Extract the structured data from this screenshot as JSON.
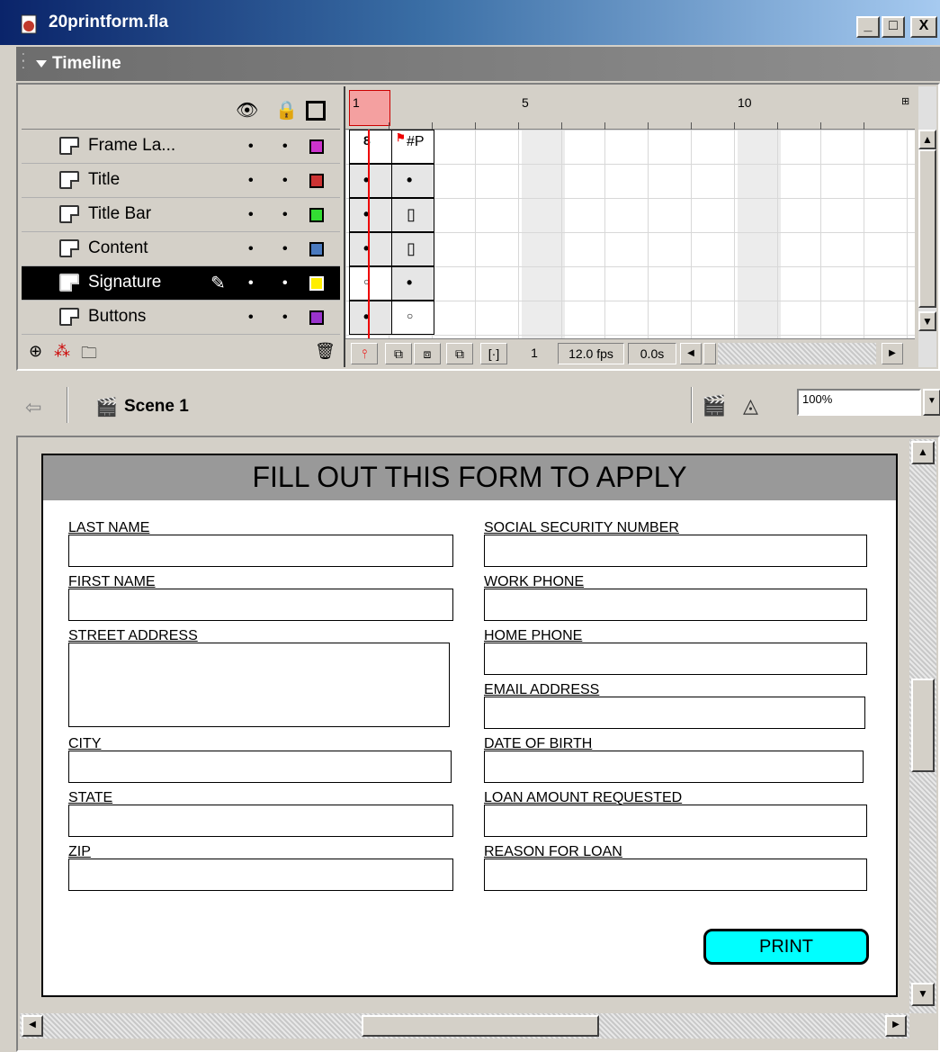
{
  "window": {
    "title": "20printform.fla",
    "min": "_",
    "max": "□",
    "close": "X"
  },
  "timeline": {
    "label": "Timeline",
    "layers": [
      {
        "name": "Frame La...",
        "color": "#cc33cc"
      },
      {
        "name": "Title",
        "color": "#cc3333"
      },
      {
        "name": "Title Bar",
        "color": "#33dd33"
      },
      {
        "name": "Content",
        "color": "#4a7abf"
      },
      {
        "name": "Signature",
        "color": "#ffee00",
        "selected": true
      },
      {
        "name": "Buttons",
        "color": "#9933cc"
      }
    ],
    "ruler": {
      "n1": "1",
      "n5": "5",
      "n10": "10"
    },
    "frame_label_marker": "#P",
    "footer": {
      "current_frame": "1",
      "fps": "12.0 fps",
      "time": "0.0s"
    }
  },
  "editbar": {
    "scene": "Scene 1",
    "zoom": "100%"
  },
  "form": {
    "title": "FILL OUT THIS FORM TO APPLY",
    "left_fields": [
      "LAST NAME",
      "FIRST NAME",
      "STREET ADDRESS",
      "CITY",
      "STATE",
      "ZIP"
    ],
    "right_fields": [
      "SOCIAL SECURITY NUMBER",
      "WORK PHONE",
      "HOME PHONE",
      "EMAIL ADDRESS",
      "DATE OF BIRTH",
      "LOAN AMOUNT REQUESTED",
      "REASON FOR LOAN"
    ],
    "print_label": "PRINT"
  }
}
